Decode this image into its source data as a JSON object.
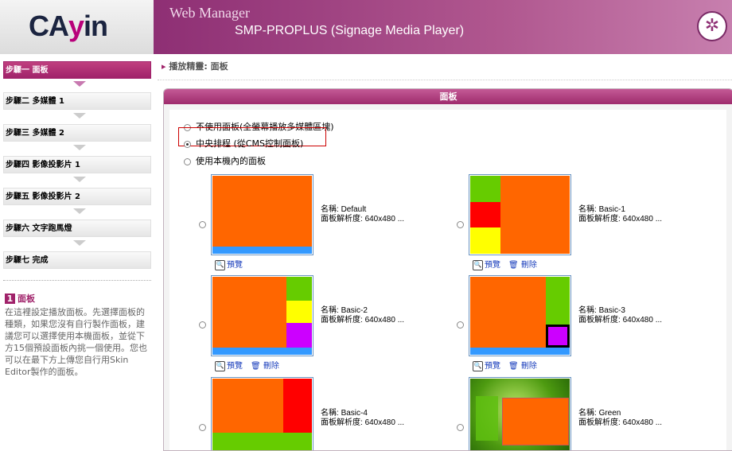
{
  "logo": {
    "brand_left": "CA",
    "brand_mid": "y",
    "brand_right": "in"
  },
  "header": {
    "title": "Web Manager",
    "subtitle": "SMP-PROPLUS (Signage Media Player)",
    "icon": "cayin-emblem-icon"
  },
  "steps": [
    {
      "label": "步驟一 面板",
      "active": true
    },
    {
      "label": "步驟二 多媒體 1"
    },
    {
      "label": "步驟三 多媒體 2"
    },
    {
      "label": "步驟四 影像投影片 1"
    },
    {
      "label": "步驟五 影像投影片 2"
    },
    {
      "label": "步驟六 文字跑馬燈"
    },
    {
      "label": "步驟七 完成"
    }
  ],
  "help": {
    "number": "1",
    "title": "面板",
    "text": "在這裡設定播放面板。先選擇面板的種類，如果您沒有自行製作面板，建議您可以選擇使用本機面板，並從下方15個預設面板內挑一個使用。您也可以在最下方上傳您自行用Skin Editor製作的面板。"
  },
  "breadcrumb": "播放精靈: 面板",
  "panel": {
    "title": "面板",
    "options": [
      "不使用面板(全螢幕播放多媒體區塊)",
      "中央排程 (從CMS控制面板)",
      "使用本機內的面板"
    ],
    "selected_option": 1
  },
  "labels": {
    "name": "名稱",
    "resolution": "面板解析度",
    "preview": "預覽",
    "delete": "刪除"
  },
  "layouts": [
    {
      "name": "Default",
      "resolution": "640x480 ...",
      "deletable": false
    },
    {
      "name": "Basic-1",
      "resolution": "640x480 ...",
      "deletable": true
    },
    {
      "name": "Basic-2",
      "resolution": "640x480 ...",
      "deletable": true
    },
    {
      "name": "Basic-3",
      "resolution": "640x480 ...",
      "deletable": true
    },
    {
      "name": "Basic-4",
      "resolution": "640x480 ...",
      "deletable": true
    },
    {
      "name": "Green",
      "resolution": "640x480 ...",
      "deletable": true
    }
  ],
  "colors": {
    "accent": "#a0226a",
    "orange": "#ff6600",
    "green": "#66cc00",
    "red": "#ff0000",
    "yellow": "#ffff00",
    "purple": "#cc00ff",
    "blue": "#3399ff"
  }
}
